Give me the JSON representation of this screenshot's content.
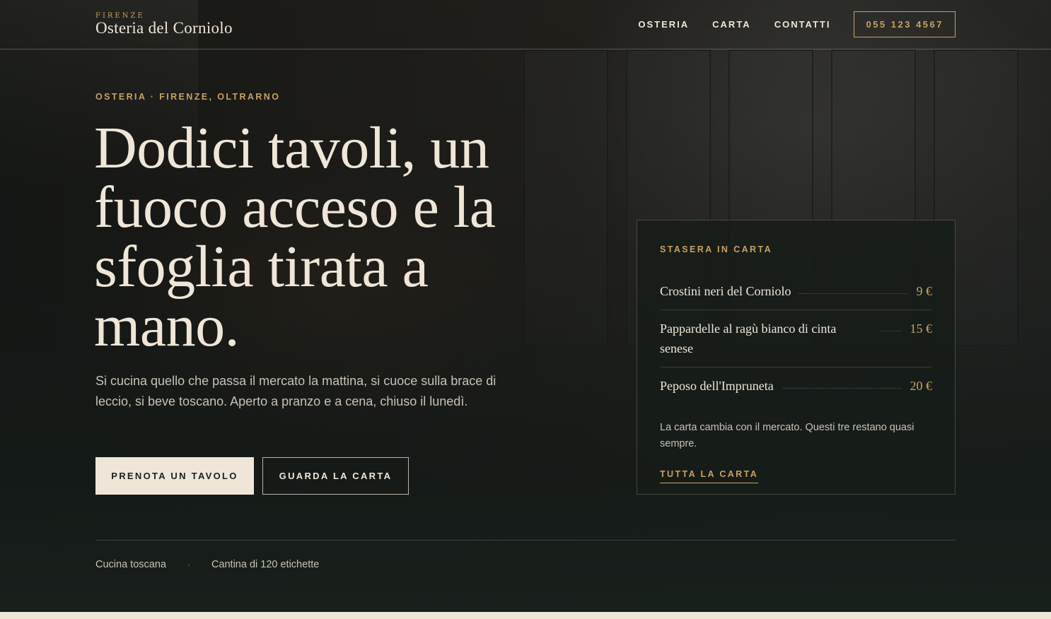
{
  "brand": {
    "city": "FIRENZE",
    "name": "Osteria del Corniolo"
  },
  "nav": {
    "items": [
      "OSTERIA",
      "CARTA",
      "CONTATTI"
    ],
    "phone": "055 123 4567"
  },
  "hero": {
    "eyebrow": "OSTERIA · FIRENZE, OLTRARNO",
    "headline": "Dodici tavoli, un fuoco acceso e la sfoglia tirata a mano.",
    "lead": "Si cucina quello che passa il mercato la mattina, si cuoce sulla brace di leccio, si beve toscano. Aperto a pranzo e a cena, chiuso il lunedì.",
    "primary_cta": "PRENOTA UN TAVOLO",
    "secondary_cta": "GUARDA LA CARTA"
  },
  "menu_card": {
    "title": "STASERA IN CARTA",
    "items": [
      {
        "dish": "Crostini neri del Corniolo",
        "price": "9 €"
      },
      {
        "dish": "Pappardelle al ragù bianco di cinta senese",
        "price": "15 €"
      },
      {
        "dish": "Peposo dell'Impruneta",
        "price": "20 €"
      }
    ],
    "note": "La carta cambia con il mercato. Questi tre restano quasi sempre.",
    "link": "TUTTA LA CARTA"
  },
  "facts": {
    "items": [
      "Cucina toscana",
      "Cantina di 120 etichette"
    ],
    "separator": "·"
  }
}
